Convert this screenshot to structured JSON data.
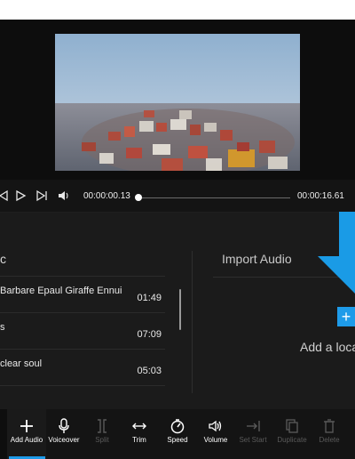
{
  "player": {
    "current_time": "00:00:00.13",
    "total_time": "00:00:16.61",
    "progress": 0.008
  },
  "music": {
    "title": "c",
    "tracks": [
      {
        "name": "Barbare Epaul Giraffe Ennui",
        "duration": "01:49"
      },
      {
        "name": "s",
        "duration": "07:09"
      },
      {
        "name": "clear soul",
        "duration": "05:03"
      }
    ]
  },
  "import": {
    "title": "Import Audio",
    "add_text": "Add a loca",
    "add_symbol": "+"
  },
  "toolbar": {
    "items": [
      {
        "label": "Add Audio",
        "icon": "plus-icon",
        "enabled": true,
        "active": true
      },
      {
        "label": "Voiceover",
        "icon": "microphone-icon",
        "enabled": true
      },
      {
        "label": "Split",
        "icon": "split-icon",
        "enabled": false
      },
      {
        "label": "Trim",
        "icon": "trim-icon",
        "enabled": true
      },
      {
        "label": "Speed",
        "icon": "speed-icon",
        "enabled": true
      },
      {
        "label": "Volume",
        "icon": "volume-icon",
        "enabled": true
      },
      {
        "label": "Set Start",
        "icon": "set-start-icon",
        "enabled": false
      },
      {
        "label": "Duplicate",
        "icon": "duplicate-icon",
        "enabled": false
      },
      {
        "label": "Delete",
        "icon": "delete-icon",
        "enabled": false
      }
    ]
  },
  "colors": {
    "accent": "#1e9be9",
    "background": "#111111",
    "panel": "#1b1b1b"
  }
}
